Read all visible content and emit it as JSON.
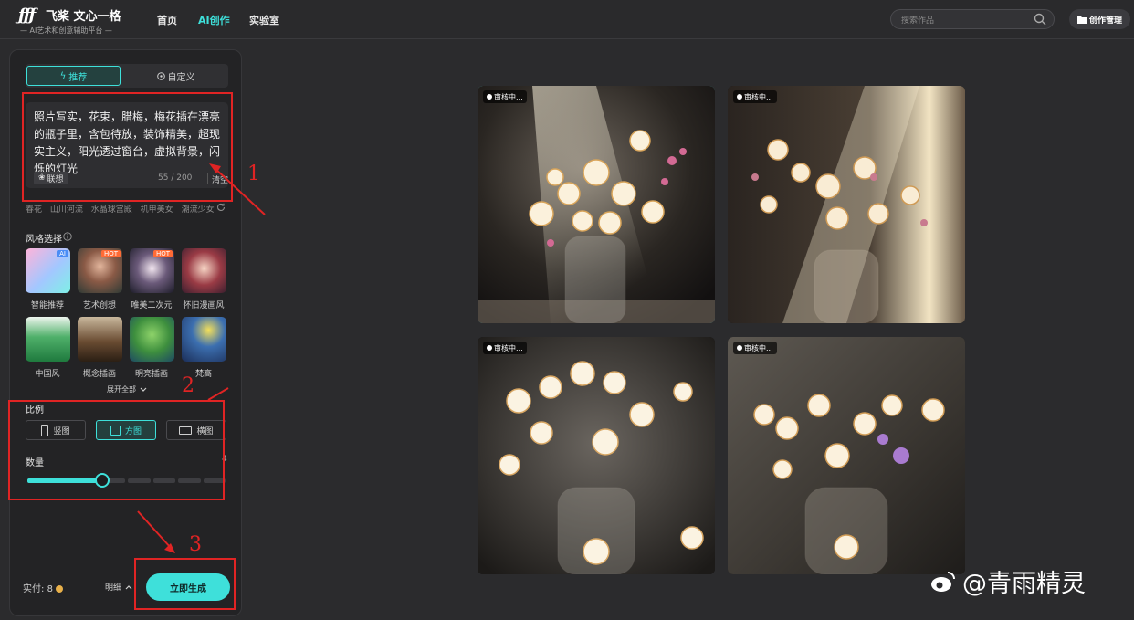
{
  "header": {
    "logo_mark": "ƒƒƒ",
    "logo_title": "飞桨 文心一格",
    "logo_subtitle": "— AI艺术和创意辅助平台 —",
    "nav": [
      "首页",
      "AI创作",
      "实验室"
    ],
    "active_nav": "AI创作",
    "search_placeholder": "搜索作品",
    "manage_label": "创作管理"
  },
  "panel": {
    "tabs": [
      "推荐",
      "自定义"
    ],
    "active_tab": "推荐",
    "prompt": "照片写实，花束，腊梅，梅花插在漂亮的瓶子里，含包待放，装饰精美，超现实主义，阳光透过窗台，虚拟背景，闪烁的灯光",
    "associate_label": "联想",
    "char_count": "55",
    "char_limit": "/ 200",
    "clear_label": "清空",
    "tags": [
      "春花",
      "山川河流",
      "水晶球宫殿",
      "机甲美女",
      "潮流少女"
    ],
    "style_label": "风格选择",
    "styles": [
      {
        "name": "智能推荐",
        "badge": "AI"
      },
      {
        "name": "艺术创想",
        "badge": "HOT"
      },
      {
        "name": "唯美二次元",
        "badge": "HOT"
      },
      {
        "name": "怀旧漫画风",
        "badge": ""
      },
      {
        "name": "中国风",
        "badge": ""
      },
      {
        "name": "概念插画",
        "badge": ""
      },
      {
        "name": "明亮插画",
        "badge": ""
      },
      {
        "name": "梵高",
        "badge": ""
      }
    ],
    "expand_label": "展开全部",
    "ratio_label": "比例",
    "ratios": [
      "竖图",
      "方图",
      "横图"
    ],
    "active_ratio": "方图",
    "quantity_label": "数量",
    "quantity_max": "4",
    "quantity_value_fraction": 0.375,
    "cost_label": "实付:",
    "cost_value": "8",
    "detail_label": "明细",
    "generate_label": "立即生成"
  },
  "results": [
    {
      "status": "审核中...",
      "selected": true
    },
    {
      "status": "审核中...",
      "selected": false
    },
    {
      "status": "审核中...",
      "selected": false
    },
    {
      "status": "审核中...",
      "selected": false
    }
  ],
  "annotations": [
    "1",
    "2",
    "3"
  ],
  "watermark": "@青雨精灵",
  "colors": {
    "accent": "#3ee0da",
    "annotation": "#e02424",
    "background": "#2b2b2d"
  }
}
